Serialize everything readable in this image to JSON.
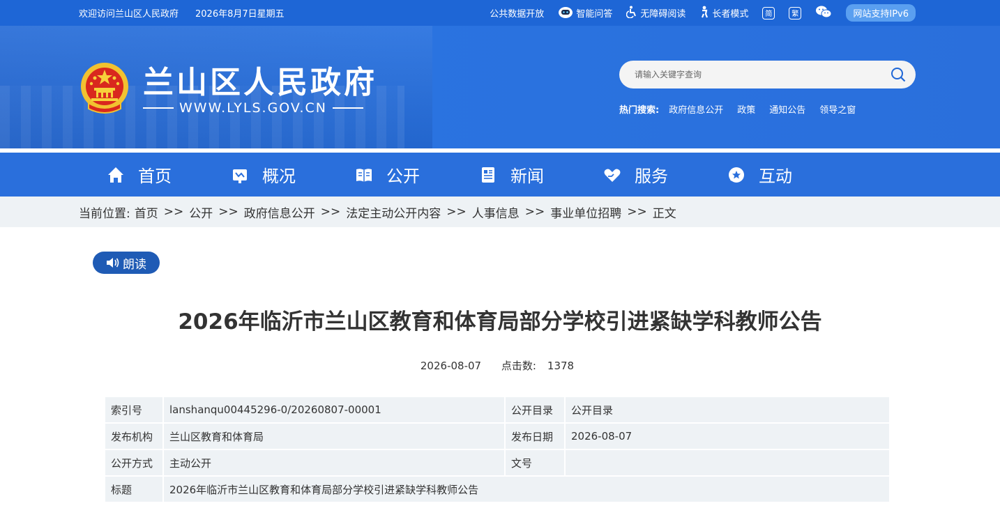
{
  "topbar": {
    "welcome": "欢迎访问兰山区人民政府",
    "date": "2026年8月7日星期五",
    "links": {
      "open_data": "公共数据开放",
      "smart_qa": "智能问答",
      "accessible": "无障碍阅读",
      "elder_mode": "长者模式",
      "simplified": "简",
      "traditional": "繁",
      "ipv6": "网站支持IPv6"
    }
  },
  "header": {
    "site_name": "兰山区人民政府",
    "site_url": "WWW.LYLS.GOV.CN",
    "search": {
      "placeholder": "请输入关键字查询"
    },
    "hot_label": "热门搜索:",
    "hot_items": [
      "政府信息公开",
      "政策",
      "通知公告",
      "领导之窗"
    ]
  },
  "nav": {
    "items": [
      {
        "label": "首页",
        "icon": "home-icon"
      },
      {
        "label": "概况",
        "icon": "overview-icon"
      },
      {
        "label": "公开",
        "icon": "book-icon"
      },
      {
        "label": "新闻",
        "icon": "news-icon"
      },
      {
        "label": "服务",
        "icon": "heart-hand-icon"
      },
      {
        "label": "互动",
        "icon": "chat-icon"
      }
    ]
  },
  "breadcrumb": {
    "prefix": "当前位置:",
    "items": [
      "首页",
      "公开",
      "政府信息公开",
      "法定主动公开内容",
      "人事信息",
      "事业单位招聘",
      "正文"
    ],
    "separator": ">>"
  },
  "article": {
    "read_label": "朗读",
    "title": "2026年临沂市兰山区教育和体育局部分学校引进紧缺学科教师公告",
    "date": "2026-08-07",
    "clicks_label": "点击数:",
    "clicks": "1378"
  },
  "info_table": {
    "index_key": "索引号",
    "index_val": "lanshanqu00445296-0/20260807-00001",
    "catalog_key": "公开目录",
    "catalog_val": "公开目录",
    "org_key": "发布机构",
    "org_val": "兰山区教育和体育局",
    "pubdate_key": "发布日期",
    "pubdate_val": "2026-08-07",
    "mode_key": "公开方式",
    "mode_val": "主动公开",
    "docno_key": "文号",
    "docno_val": "",
    "title_key": "标题",
    "title_val": "2026年临沂市兰山区教育和体育局部分学校引进紧缺学科教师公告"
  },
  "colors": {
    "primary_blue": "#2a6fdc",
    "topbar_blue": "#1e66d6",
    "read_button": "#1f5bb5",
    "table_bg": "#eef2f5"
  }
}
